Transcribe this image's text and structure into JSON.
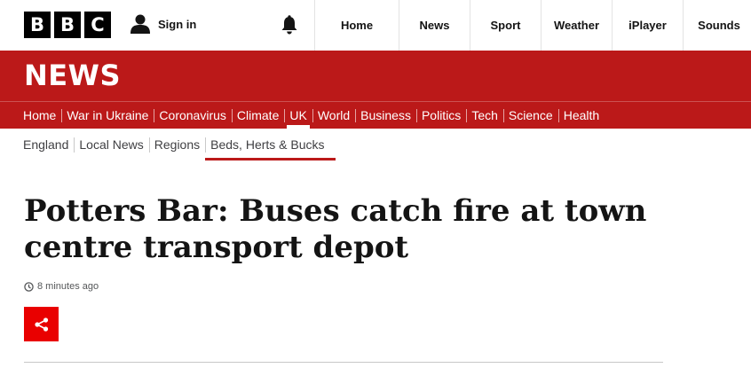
{
  "header": {
    "logo_letters": [
      "B",
      "B",
      "C"
    ],
    "signin_label": "Sign in",
    "nav": [
      "Home",
      "News",
      "Sport",
      "Weather",
      "iPlayer",
      "Sounds"
    ]
  },
  "banner": {
    "title": "NEWS"
  },
  "section_nav": {
    "items": [
      "Home",
      "War in Ukraine",
      "Coronavirus",
      "Climate",
      "UK",
      "World",
      "Business",
      "Politics",
      "Tech",
      "Science",
      "Health"
    ],
    "active": "UK"
  },
  "sub_nav": {
    "items": [
      "England",
      "Local News",
      "Regions",
      "Beds, Herts & Bucks"
    ],
    "active": "Beds, Herts & Bucks"
  },
  "article": {
    "headline": "Potters Bar: Buses catch fire at town centre transport depot",
    "timestamp": "8 minutes ago"
  },
  "icons": {
    "user": "user-icon",
    "bell": "bell-icon",
    "clock": "clock-icon",
    "share": "share-icon"
  },
  "colors": {
    "brand_red": "#bb1919",
    "share_red": "#e90000",
    "text": "#141414"
  }
}
